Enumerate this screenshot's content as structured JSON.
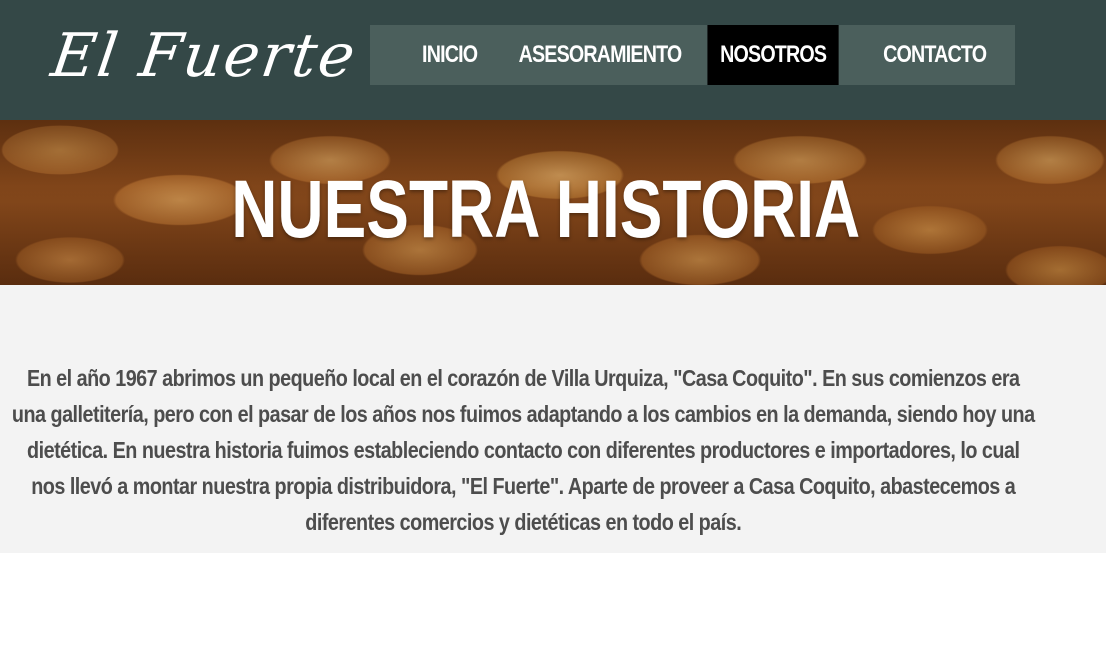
{
  "header": {
    "logo_text": "El Fuerte",
    "nav": [
      {
        "label": "INICIO",
        "active": false
      },
      {
        "label": "ASESORAMIENTO",
        "active": false
      },
      {
        "label": "NOSOTROS",
        "active": true
      },
      {
        "label": "CONTACTO",
        "active": false
      }
    ]
  },
  "hero": {
    "title": "NUESTRA HISTORIA"
  },
  "content": {
    "paragraph": "En el año 1967 abrimos un pequeño local en el corazón de Villa Urquiza, \"Casa Coquito\". En sus comienzos era una galletitería, pero con el pasar de los años nos fuimos adaptando a los cambios en la demanda, siendo hoy una dietética. En nuestra historia fuimos estableciendo contacto con diferentes productores e importadores, lo cual nos llevó a montar nuestra propia distribuidora, \"El Fuerte\". Aparte de proveer a Casa Coquito, abastecemos a diferentes comercios y dietéticas en todo el país."
  },
  "colors": {
    "header_bg": "#344847",
    "nav_bg": "#4b5f5c",
    "nav_active_bg": "#000000",
    "content_bg": "#f3f3f3",
    "text": "#4d4d4d"
  }
}
